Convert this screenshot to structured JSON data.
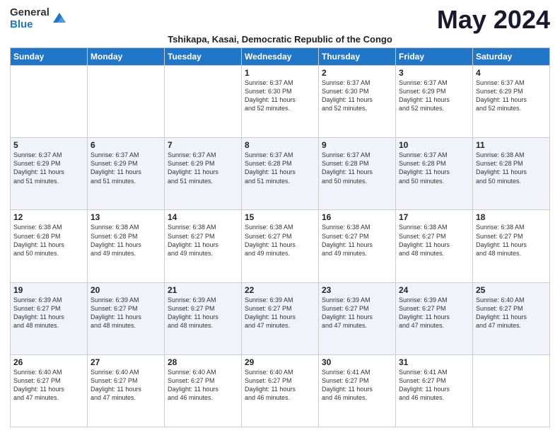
{
  "header": {
    "logo_general": "General",
    "logo_blue": "Blue",
    "month_title": "May 2024",
    "subtitle": "Tshikapa, Kasai, Democratic Republic of the Congo"
  },
  "weekdays": [
    "Sunday",
    "Monday",
    "Tuesday",
    "Wednesday",
    "Thursday",
    "Friday",
    "Saturday"
  ],
  "weeks": [
    [
      {
        "day": "",
        "info": ""
      },
      {
        "day": "",
        "info": ""
      },
      {
        "day": "",
        "info": ""
      },
      {
        "day": "1",
        "info": "Sunrise: 6:37 AM\nSunset: 6:30 PM\nDaylight: 11 hours\nand 52 minutes."
      },
      {
        "day": "2",
        "info": "Sunrise: 6:37 AM\nSunset: 6:30 PM\nDaylight: 11 hours\nand 52 minutes."
      },
      {
        "day": "3",
        "info": "Sunrise: 6:37 AM\nSunset: 6:29 PM\nDaylight: 11 hours\nand 52 minutes."
      },
      {
        "day": "4",
        "info": "Sunrise: 6:37 AM\nSunset: 6:29 PM\nDaylight: 11 hours\nand 52 minutes."
      }
    ],
    [
      {
        "day": "5",
        "info": "Sunrise: 6:37 AM\nSunset: 6:29 PM\nDaylight: 11 hours\nand 51 minutes."
      },
      {
        "day": "6",
        "info": "Sunrise: 6:37 AM\nSunset: 6:29 PM\nDaylight: 11 hours\nand 51 minutes."
      },
      {
        "day": "7",
        "info": "Sunrise: 6:37 AM\nSunset: 6:29 PM\nDaylight: 11 hours\nand 51 minutes."
      },
      {
        "day": "8",
        "info": "Sunrise: 6:37 AM\nSunset: 6:28 PM\nDaylight: 11 hours\nand 51 minutes."
      },
      {
        "day": "9",
        "info": "Sunrise: 6:37 AM\nSunset: 6:28 PM\nDaylight: 11 hours\nand 50 minutes."
      },
      {
        "day": "10",
        "info": "Sunrise: 6:37 AM\nSunset: 6:28 PM\nDaylight: 11 hours\nand 50 minutes."
      },
      {
        "day": "11",
        "info": "Sunrise: 6:38 AM\nSunset: 6:28 PM\nDaylight: 11 hours\nand 50 minutes."
      }
    ],
    [
      {
        "day": "12",
        "info": "Sunrise: 6:38 AM\nSunset: 6:28 PM\nDaylight: 11 hours\nand 50 minutes."
      },
      {
        "day": "13",
        "info": "Sunrise: 6:38 AM\nSunset: 6:28 PM\nDaylight: 11 hours\nand 49 minutes."
      },
      {
        "day": "14",
        "info": "Sunrise: 6:38 AM\nSunset: 6:27 PM\nDaylight: 11 hours\nand 49 minutes."
      },
      {
        "day": "15",
        "info": "Sunrise: 6:38 AM\nSunset: 6:27 PM\nDaylight: 11 hours\nand 49 minutes."
      },
      {
        "day": "16",
        "info": "Sunrise: 6:38 AM\nSunset: 6:27 PM\nDaylight: 11 hours\nand 49 minutes."
      },
      {
        "day": "17",
        "info": "Sunrise: 6:38 AM\nSunset: 6:27 PM\nDaylight: 11 hours\nand 48 minutes."
      },
      {
        "day": "18",
        "info": "Sunrise: 6:38 AM\nSunset: 6:27 PM\nDaylight: 11 hours\nand 48 minutes."
      }
    ],
    [
      {
        "day": "19",
        "info": "Sunrise: 6:39 AM\nSunset: 6:27 PM\nDaylight: 11 hours\nand 48 minutes."
      },
      {
        "day": "20",
        "info": "Sunrise: 6:39 AM\nSunset: 6:27 PM\nDaylight: 11 hours\nand 48 minutes."
      },
      {
        "day": "21",
        "info": "Sunrise: 6:39 AM\nSunset: 6:27 PM\nDaylight: 11 hours\nand 48 minutes."
      },
      {
        "day": "22",
        "info": "Sunrise: 6:39 AM\nSunset: 6:27 PM\nDaylight: 11 hours\nand 47 minutes."
      },
      {
        "day": "23",
        "info": "Sunrise: 6:39 AM\nSunset: 6:27 PM\nDaylight: 11 hours\nand 47 minutes."
      },
      {
        "day": "24",
        "info": "Sunrise: 6:39 AM\nSunset: 6:27 PM\nDaylight: 11 hours\nand 47 minutes."
      },
      {
        "day": "25",
        "info": "Sunrise: 6:40 AM\nSunset: 6:27 PM\nDaylight: 11 hours\nand 47 minutes."
      }
    ],
    [
      {
        "day": "26",
        "info": "Sunrise: 6:40 AM\nSunset: 6:27 PM\nDaylight: 11 hours\nand 47 minutes."
      },
      {
        "day": "27",
        "info": "Sunrise: 6:40 AM\nSunset: 6:27 PM\nDaylight: 11 hours\nand 47 minutes."
      },
      {
        "day": "28",
        "info": "Sunrise: 6:40 AM\nSunset: 6:27 PM\nDaylight: 11 hours\nand 46 minutes."
      },
      {
        "day": "29",
        "info": "Sunrise: 6:40 AM\nSunset: 6:27 PM\nDaylight: 11 hours\nand 46 minutes."
      },
      {
        "day": "30",
        "info": "Sunrise: 6:41 AM\nSunset: 6:27 PM\nDaylight: 11 hours\nand 46 minutes."
      },
      {
        "day": "31",
        "info": "Sunrise: 6:41 AM\nSunset: 6:27 PM\nDaylight: 11 hours\nand 46 minutes."
      },
      {
        "day": "",
        "info": ""
      }
    ]
  ]
}
